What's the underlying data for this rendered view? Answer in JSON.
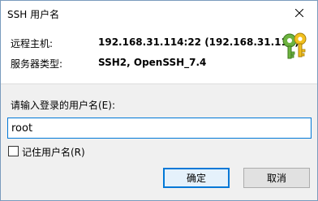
{
  "window": {
    "title": "SSH 用户名",
    "close_icon": "close-icon"
  },
  "info": {
    "host_label": "远程主机:",
    "host_value": "192.168.31.114:22 (192.168.31.114)",
    "server_type_label": "服务器类型:",
    "server_type_value": "SSH2, OpenSSH_7.4",
    "icon": "keys-icon"
  },
  "form": {
    "prompt": "请输入登录的用户名(E):",
    "username_value": "root",
    "remember_label": "记住用户名(R)",
    "remember_checked": false
  },
  "buttons": {
    "ok_label": "确定",
    "cancel_label": "取消"
  },
  "colors": {
    "accent": "#0078d7",
    "dialog_body": "#f0f0f0"
  }
}
